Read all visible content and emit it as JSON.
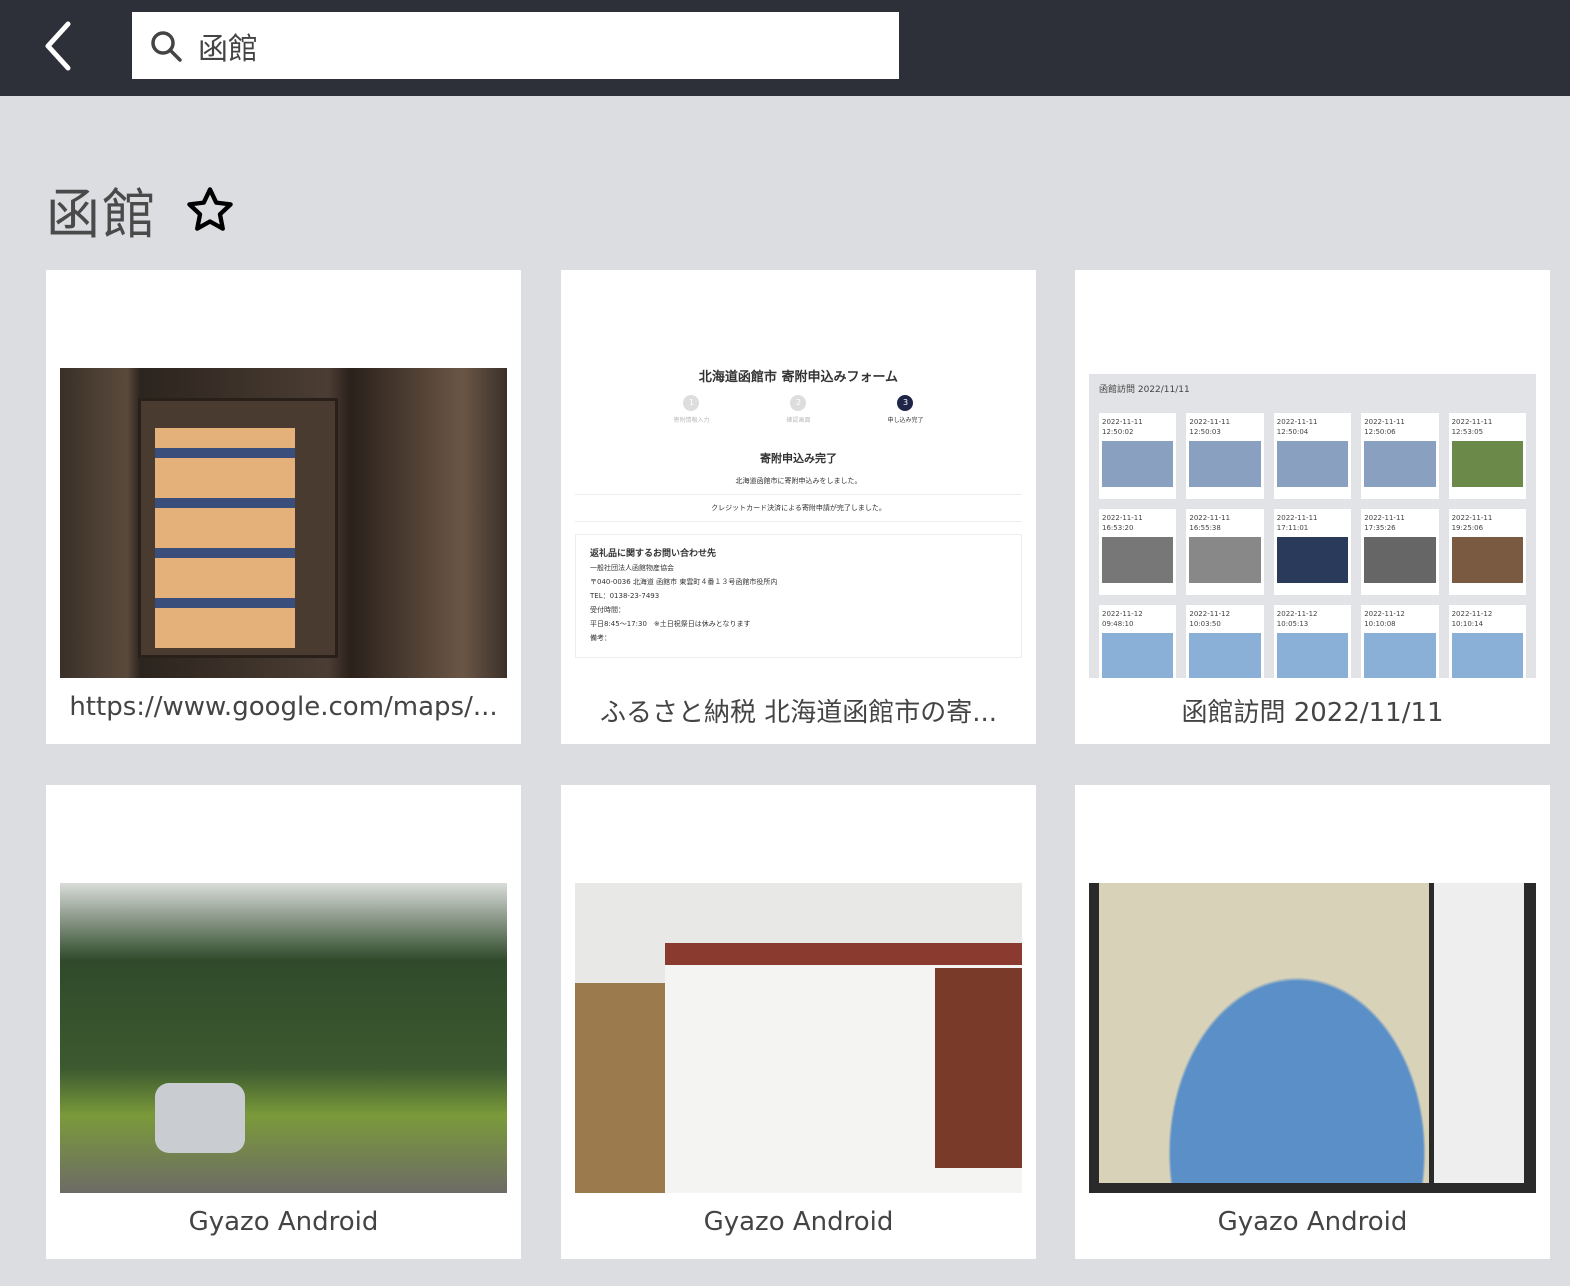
{
  "header": {
    "search_value": "函館",
    "back_icon": "chevron-left-icon",
    "search_icon": "search-icon"
  },
  "page": {
    "title": "函館",
    "star_icon": "star-outline-icon"
  },
  "cards": [
    {
      "caption": "https://www.google.com/maps/...",
      "thumb": "photo"
    },
    {
      "caption": "ふるさと納税 北海道函館市の寄...",
      "thumb": "form",
      "form": {
        "title": "北海道函館市 寄附申込みフォーム",
        "steps": [
          "寄附情報入力",
          "確認画面",
          "申し込み完了"
        ],
        "status": "寄附申込み完了",
        "line1": "北海道函館市に寄附申込みをしました。",
        "line2": "クレジットカード決済による寄附申請が完了しました。",
        "contact_title": "返礼品に関するお問い合わせ先",
        "contact_lines": [
          "一般社団法人函館物産協会",
          "〒040-0036 北海道 函館市 東雲町４番１３号函館市役所内",
          "TEL：0138-23-7493",
          "受付時間：",
          "平日8:45〜17:30　※土日祝祭日は休みとなります",
          "備考："
        ]
      }
    },
    {
      "caption": "函館訪問 2022/11/11",
      "thumb": "gallery",
      "gallery": {
        "title": "函館訪問 2022/11/11",
        "items": [
          [
            "2022-11-11",
            "12:50:02"
          ],
          [
            "2022-11-11",
            "12:50:03"
          ],
          [
            "2022-11-11",
            "12:50:04"
          ],
          [
            "2022-11-11",
            "12:50:06"
          ],
          [
            "2022-11-11",
            "12:53:05"
          ],
          [
            "2022-11-11",
            "16:53:20"
          ],
          [
            "2022-11-11",
            "16:55:38"
          ],
          [
            "2022-11-11",
            "17:11:01"
          ],
          [
            "2022-11-11",
            "17:35:26"
          ],
          [
            "2022-11-11",
            "19:25:06"
          ],
          [
            "2022-11-12",
            "09:48:10"
          ],
          [
            "2022-11-12",
            "10:03:50"
          ],
          [
            "2022-11-12",
            "10:05:13"
          ],
          [
            "2022-11-12",
            "10:10:08"
          ],
          [
            "2022-11-12",
            "10:10:14"
          ]
        ]
      }
    },
    {
      "caption": "Gyazo Android",
      "thumb": "photo"
    },
    {
      "caption": "Gyazo Android",
      "thumb": "photo"
    },
    {
      "caption": "Gyazo Android",
      "thumb": "photo"
    }
  ]
}
